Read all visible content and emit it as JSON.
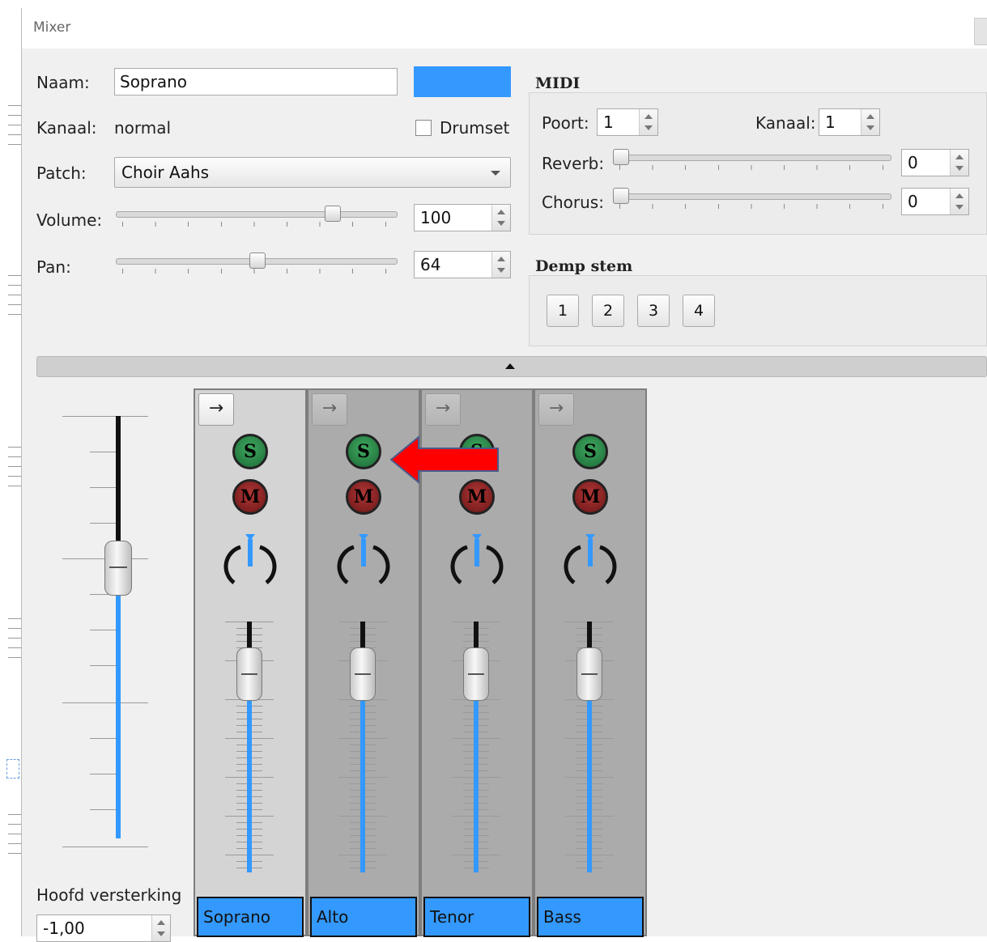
{
  "window": {
    "title": "Mixer"
  },
  "instrument": {
    "name_label": "Naam:",
    "name_value": "Soprano",
    "color": "#3399ff",
    "channel_label": "Kanaal:",
    "channel_value": "normal",
    "drumset_label": "Drumset",
    "drumset_checked": false,
    "patch_label": "Patch:",
    "patch_value": "Choir Aahs",
    "volume_label": "Volume:",
    "volume_value": "100",
    "volume_max": 127,
    "pan_label": "Pan:",
    "pan_value": "64",
    "pan_max": 127
  },
  "midi": {
    "title": "MIDI",
    "port_label": "Poort:",
    "port_value": "1",
    "channel_label": "Kanaal:",
    "channel_value": "1",
    "reverb_label": "Reverb:",
    "reverb_value": "0",
    "chorus_label": "Chorus:",
    "chorus_value": "0"
  },
  "mute_voice": {
    "title": "Demp stem",
    "buttons": [
      "1",
      "2",
      "3",
      "4"
    ]
  },
  "master": {
    "label": "Hoofd versterking",
    "value": "-1,00"
  },
  "strips": [
    {
      "name": "Soprano",
      "arrow": "→",
      "solo": "S",
      "mute": "M",
      "selected": true
    },
    {
      "name": "Alto",
      "arrow": "→",
      "solo": "S",
      "mute": "M",
      "selected": false
    },
    {
      "name": "Tenor",
      "arrow": "→",
      "solo": "S",
      "mute": "M",
      "selected": false
    },
    {
      "name": "Bass",
      "arrow": "→",
      "solo": "S",
      "mute": "M",
      "selected": false
    }
  ],
  "colors": {
    "accent": "#3399ff",
    "solo": "#2e8b4a",
    "mute": "#8b2222",
    "annotation_arrow": "#ff0000"
  },
  "icons": {
    "expand": "arrow-right-icon",
    "collapse": "caret-up-icon",
    "annotation": "red-arrow-left-icon"
  }
}
